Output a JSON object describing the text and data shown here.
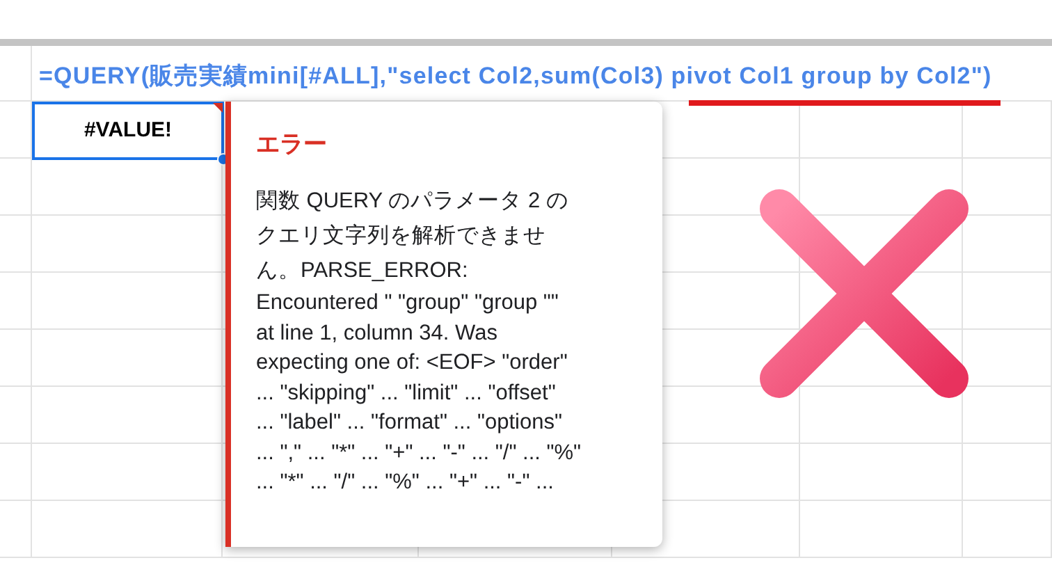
{
  "formula_text": "=QUERY(販売実績mini[#ALL],\"select Col2,sum(Col3) pivot Col1 group by Col2\")",
  "cell": {
    "value": "#VALUE!",
    "selected": true
  },
  "error_popup": {
    "title": "エラー",
    "message_lines": [
      "関数 QUERY のパラメータ 2 の",
      "クエリ文字列を解析できませ",
      "ん。PARSE_ERROR:",
      "Encountered \" \"group\" \"group \"\"",
      "at line 1, column 34. Was",
      "expecting one of: <EOF> \"order\"",
      "... \"skipping\" ... \"limit\" ... \"offset\"",
      "... \"label\" ... \"format\" ... \"options\"",
      "... \",\" ... \"*\" ... \"+\" ... \"-\" ... \"/\" ... \"%\"",
      "... \"*\" ... \"/\" ... \"%\" ... \"+\" ... \"-\" ..."
    ]
  }
}
